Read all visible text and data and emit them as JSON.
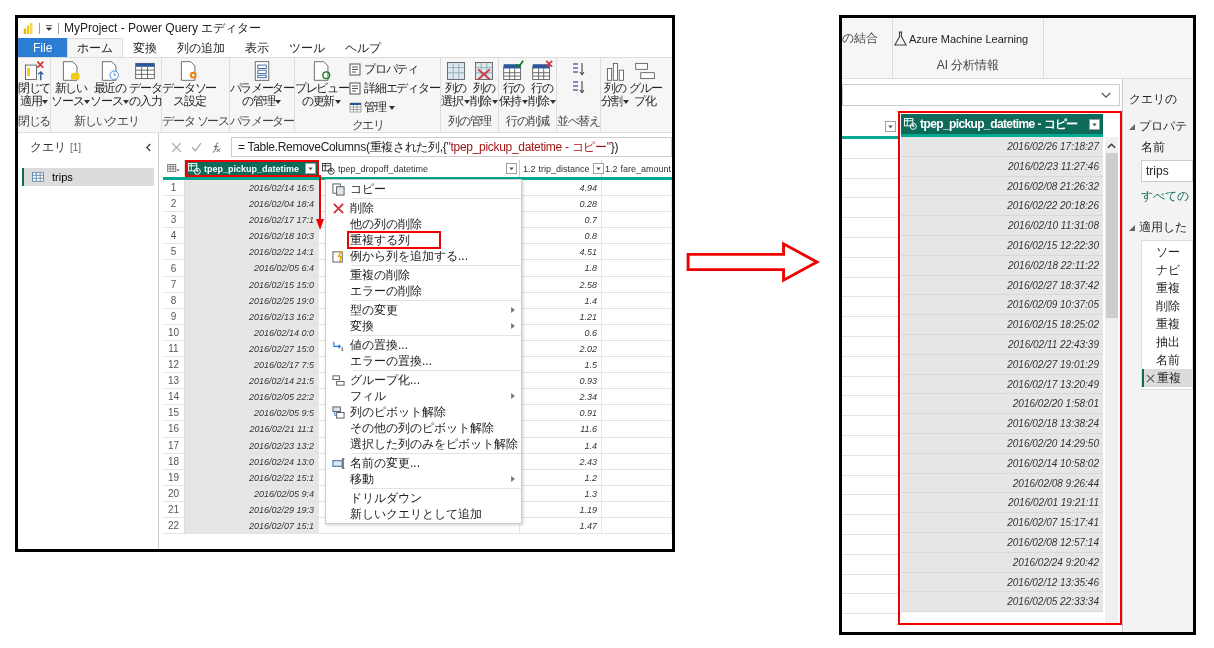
{
  "left_screenshot": {
    "window_title": "MyProject - Power Query エディター",
    "ribbon_tabs": [
      {
        "label": "File",
        "kind": "file",
        "selected": false
      },
      {
        "label": "ホーム",
        "kind": "tab",
        "selected": true
      },
      {
        "label": "変換",
        "kind": "tab",
        "selected": false
      },
      {
        "label": "列の追加",
        "kind": "tab",
        "selected": false
      },
      {
        "label": "表示",
        "kind": "tab",
        "selected": false
      },
      {
        "label": "ツール",
        "kind": "tab",
        "selected": false
      },
      {
        "label": "ヘルプ",
        "kind": "tab",
        "selected": false
      }
    ],
    "ribbon_groups": [
      {
        "label": "閉じる",
        "buttons": [
          {
            "kind": "large",
            "lines": [
              "閉じて",
              "適用"
            ],
            "dropdown": true
          }
        ]
      },
      {
        "label": "新しいクエリ",
        "buttons": [
          {
            "kind": "large",
            "lines": [
              "新しい",
              "ソース"
            ],
            "dropdown": true
          },
          {
            "kind": "large",
            "lines": [
              "最近の",
              "ソース"
            ],
            "dropdown": true
          },
          {
            "kind": "large",
            "lines": [
              "データ",
              "の入力"
            ],
            "dropdown": false
          }
        ]
      },
      {
        "label": "データ ソース",
        "buttons": [
          {
            "kind": "large",
            "lines": [
              "データソー",
              "ス設定"
            ],
            "dropdown": false
          }
        ]
      },
      {
        "label": "パラメーター",
        "buttons": [
          {
            "kind": "large",
            "lines": [
              "パラメーター",
              "の管理"
            ],
            "dropdown": true
          }
        ]
      },
      {
        "label": "クエリ",
        "buttons": [
          {
            "kind": "large",
            "lines": [
              "プレビュー",
              "の更新"
            ],
            "dropdown": true
          },
          {
            "kind": "small",
            "lines": [
              "プロパティ"
            ],
            "dropdown": false
          },
          {
            "kind": "small",
            "lines": [
              "詳細エディター"
            ],
            "dropdown": false
          },
          {
            "kind": "small",
            "lines": [
              "管理"
            ],
            "dropdown": true
          }
        ]
      },
      {
        "label": "列の管理",
        "buttons": [
          {
            "kind": "large",
            "lines": [
              "列の",
              "選択"
            ],
            "dropdown": true
          },
          {
            "kind": "large",
            "lines": [
              "列の",
              "削除"
            ],
            "dropdown": true
          }
        ]
      },
      {
        "label": "行の削減",
        "buttons": [
          {
            "kind": "large",
            "lines": [
              "行の",
              "保持"
            ],
            "dropdown": true
          },
          {
            "kind": "large",
            "lines": [
              "行の",
              "削除"
            ],
            "dropdown": true
          }
        ]
      },
      {
        "label": "並べ替え",
        "buttons": [
          {
            "kind": "icon",
            "dropdown": false
          },
          {
            "kind": "icon",
            "dropdown": false
          }
        ]
      },
      {
        "buttons": [
          {
            "kind": "large",
            "lines": [
              "列の",
              "分割"
            ],
            "dropdown": true
          },
          {
            "kind": "large",
            "lines": [
              "グルー",
              "プ化"
            ],
            "dropdown": false
          }
        ]
      }
    ],
    "queries_pane": {
      "title": "クエリ",
      "count": "[1]",
      "items": [
        {
          "label": "trips",
          "selected": true
        }
      ]
    },
    "formula": {
      "prefix": "= Table.RemoveColumns(重複された列,{",
      "string": "\"tpep_pickup_datetime - コピー\"",
      "suffix": "})"
    },
    "columns": [
      {
        "name": "tpep_pickup_datetime",
        "kind": "datetime",
        "selected": true,
        "annotated": true
      },
      {
        "name": "tpep_dropoff_datetime",
        "kind": "datetime",
        "selected": false,
        "annotated": false
      },
      {
        "name": "trip_distance",
        "kind": "number",
        "type": "1.2",
        "selected": false,
        "annotated": false
      },
      {
        "name": "fare_amount",
        "kind": "number",
        "type": "1.2",
        "selected": false,
        "annotated": false
      }
    ],
    "rows": [
      {
        "n": "1",
        "pickup": "2016/02/14 16:5",
        "distance": "4.94"
      },
      {
        "n": "2",
        "pickup": "2016/02/04 18:4",
        "distance": "0.28"
      },
      {
        "n": "3",
        "pickup": "2016/02/17 17:1",
        "distance": "0.7"
      },
      {
        "n": "4",
        "pickup": "2016/02/18 10:3",
        "distance": "0.8"
      },
      {
        "n": "5",
        "pickup": "2016/02/22 14:1",
        "distance": "4.51"
      },
      {
        "n": "6",
        "pickup": "2016/02/05 6:4",
        "distance": "1.8"
      },
      {
        "n": "7",
        "pickup": "2016/02/15 15:0",
        "distance": "2.58"
      },
      {
        "n": "8",
        "pickup": "2016/02/25 19:0",
        "distance": "1.4"
      },
      {
        "n": "9",
        "pickup": "2016/02/13 16:2",
        "distance": "1.21"
      },
      {
        "n": "10",
        "pickup": "2016/02/14 0:0",
        "distance": "0.6"
      },
      {
        "n": "11",
        "pickup": "2016/02/27 15:0",
        "distance": "2.02"
      },
      {
        "n": "12",
        "pickup": "2016/02/17 7:5",
        "distance": "1.5"
      },
      {
        "n": "13",
        "pickup": "2016/02/14 21:5",
        "distance": "0.93"
      },
      {
        "n": "14",
        "pickup": "2016/02/05 22:2",
        "distance": "2.34"
      },
      {
        "n": "15",
        "pickup": "2016/02/05 9:5",
        "distance": "0.91"
      },
      {
        "n": "16",
        "pickup": "2016/02/21 11:1",
        "distance": "11.6"
      },
      {
        "n": "17",
        "pickup": "2016/02/23 13:2",
        "distance": "1.4"
      },
      {
        "n": "18",
        "pickup": "2016/02/24 13:0",
        "distance": "2.43"
      },
      {
        "n": "19",
        "pickup": "2016/02/22 15:1",
        "distance": "1.2"
      },
      {
        "n": "20",
        "pickup": "2016/02/05 9:4",
        "distance": "1.3"
      },
      {
        "n": "21",
        "pickup": "2016/02/29 19:3",
        "distance": "1.19"
      },
      {
        "n": "22",
        "pickup": "2016/02/07 15:1",
        "distance": "1.47"
      }
    ],
    "context_menu": [
      [
        {
          "label": "コピー",
          "icon": true,
          "submenu": false,
          "annotated": false
        }
      ],
      [
        {
          "label": "削除",
          "icon": true,
          "submenu": false,
          "annotated": false
        },
        {
          "label": "他の列の削除",
          "icon": false,
          "submenu": false,
          "annotated": false
        },
        {
          "label": "重複する列",
          "icon": false,
          "submenu": false,
          "annotated": true
        },
        {
          "label": "例から列を追加する...",
          "icon": true,
          "submenu": false,
          "annotated": false
        }
      ],
      [
        {
          "label": "重複の削除",
          "icon": false,
          "submenu": false,
          "annotated": false
        },
        {
          "label": "エラーの削除",
          "icon": false,
          "submenu": false,
          "annotated": false
        }
      ],
      [
        {
          "label": "型の変更",
          "icon": false,
          "submenu": true,
          "annotated": false
        },
        {
          "label": "変換",
          "icon": false,
          "submenu": true,
          "annotated": false
        }
      ],
      [
        {
          "label": "値の置換...",
          "icon": true,
          "submenu": false,
          "annotated": false
        },
        {
          "label": "エラーの置換...",
          "icon": false,
          "submenu": false,
          "annotated": false
        }
      ],
      [
        {
          "label": "グループ化...",
          "icon": true,
          "submenu": false,
          "annotated": false
        },
        {
          "label": "フィル",
          "icon": false,
          "submenu": true,
          "annotated": false
        },
        {
          "label": "列のピボット解除",
          "icon": true,
          "submenu": false,
          "annotated": false
        },
        {
          "label": "その他の列のピボット解除",
          "icon": false,
          "submenu": false,
          "annotated": false
        },
        {
          "label": "選択した列のみをピボット解除",
          "icon": false,
          "submenu": false,
          "annotated": false
        }
      ],
      [
        {
          "label": "名前の変更...",
          "icon": true,
          "submenu": false,
          "annotated": false
        },
        {
          "label": "移動",
          "icon": false,
          "submenu": true,
          "annotated": false
        }
      ],
      [
        {
          "label": "ドリルダウン",
          "icon": false,
          "submenu": false,
          "annotated": false
        },
        {
          "label": "新しいクエリとして追加",
          "icon": false,
          "submenu": false,
          "annotated": false
        }
      ]
    ]
  },
  "right_screenshot": {
    "ribbon_cut_label": "の結合",
    "ribbon_button": "Azure Machine Learning",
    "ribbon_group": "AI 分析情報",
    "column": {
      "name": "tpep_pickup_datetime - コピー",
      "annotated": true
    },
    "values": [
      "2016/02/26 17:18:27",
      "2016/02/23 11:27:46",
      "2016/02/08 21:26:32",
      "2016/02/22 20:18:26",
      "2016/02/10 11:31:08",
      "2016/02/15 12:22:30",
      "2016/02/18 22:11:22",
      "2016/02/27 18:37:42",
      "2016/02/09 10:37:05",
      "2016/02/15 18:25:02",
      "2016/02/11 22:43:39",
      "2016/02/27 19:01:29",
      "2016/02/17 13:20:49",
      "2016/02/20 1:58:01",
      "2016/02/18 13:38:24",
      "2016/02/20 14:29:50",
      "2016/02/14 10:58:02",
      "2016/02/08 9:26:44",
      "2016/02/01 19:21:11",
      "2016/02/07 15:17:41",
      "2016/02/08 12:57:14",
      "2016/02/24 9:20:42",
      "2016/02/12 13:35:46",
      "2016/02/05 22:33:34"
    ],
    "settings": {
      "title": "クエリの",
      "properties": "プロパテ",
      "name_label": "名前",
      "name_value": "trips",
      "all_link": "すべての",
      "steps_title": "適用した",
      "steps": [
        {
          "label": "ソー",
          "selected": false
        },
        {
          "label": "ナビ",
          "selected": false
        },
        {
          "label": "重複",
          "selected": false
        },
        {
          "label": "削除",
          "selected": false
        },
        {
          "label": "重複",
          "selected": false
        },
        {
          "label": "抽出",
          "selected": false
        },
        {
          "label": "名前",
          "selected": false
        },
        {
          "label": "重複",
          "selected": true
        }
      ]
    }
  }
}
